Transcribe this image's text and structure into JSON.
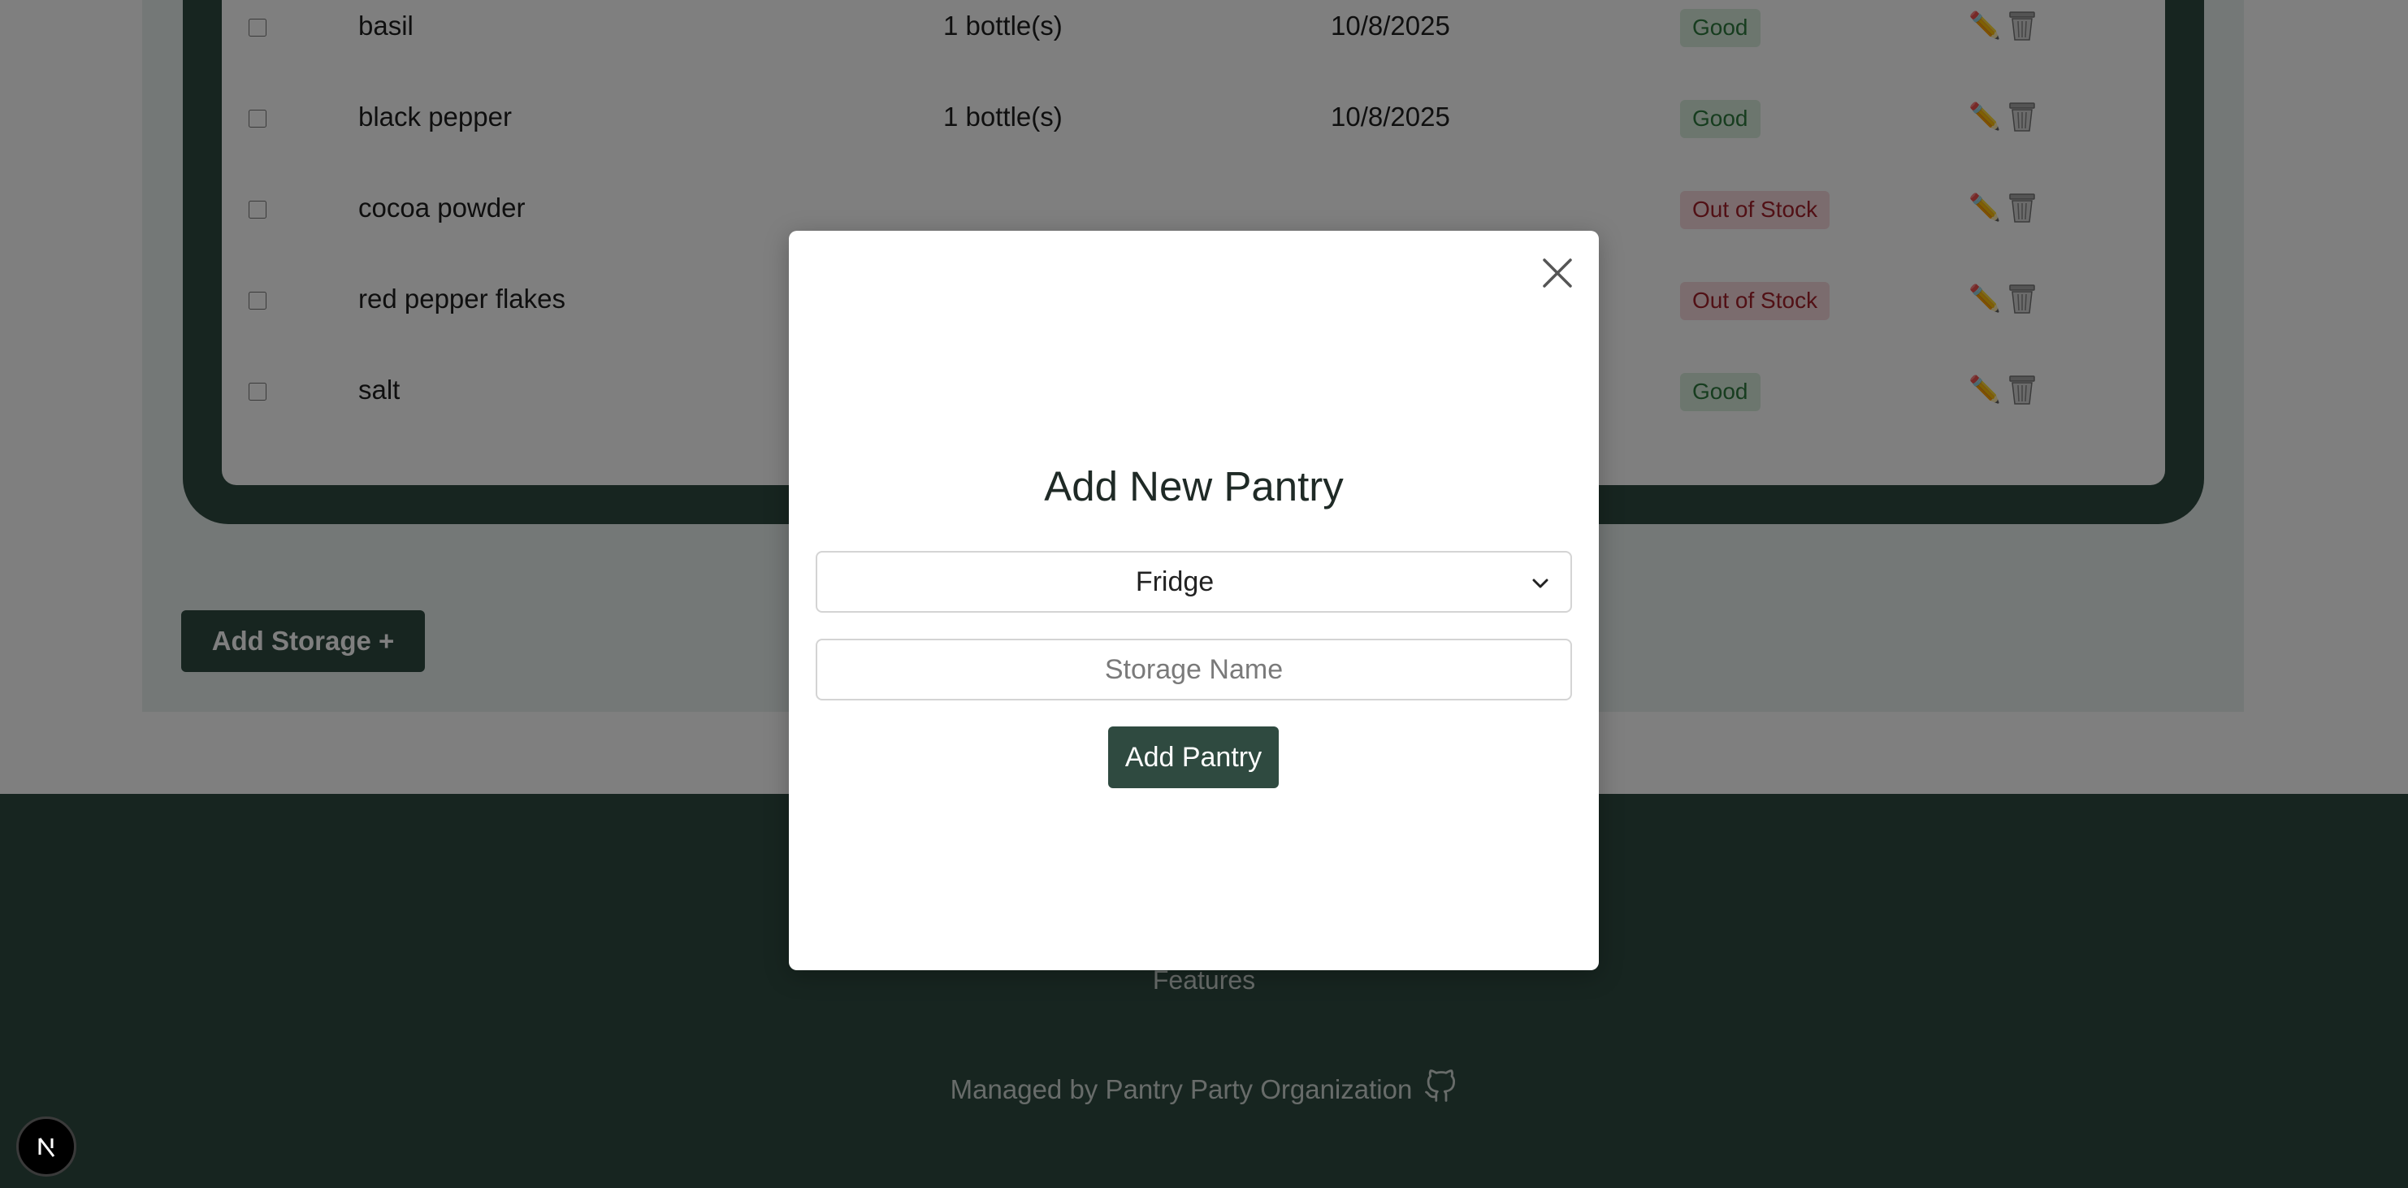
{
  "table": {
    "rows": [
      {
        "name": "basil",
        "quantity": "1 bottle(s)",
        "date": "10/8/2025",
        "status": "Good",
        "status_type": "good"
      },
      {
        "name": "black pepper",
        "quantity": "1 bottle(s)",
        "date": "10/8/2025",
        "status": "Good",
        "status_type": "good"
      },
      {
        "name": "cocoa powder",
        "quantity": "",
        "date": "",
        "status": "Out of Stock",
        "status_type": "out"
      },
      {
        "name": "red pepper flakes",
        "quantity": "",
        "date": "",
        "status": "Out of Stock",
        "status_type": "out"
      },
      {
        "name": "salt",
        "quantity": "",
        "date": "",
        "status": "Good",
        "status_type": "good"
      }
    ],
    "edit_icon": "pencil-icon",
    "delete_icon": "trash-icon"
  },
  "add_storage_label": "Add Storage +",
  "modal": {
    "title": "Add New Pantry",
    "select_value": "Fridge",
    "storage_name_placeholder": "Storage Name",
    "storage_name_value": "",
    "submit_label": "Add Pantry",
    "close_icon": "close-icon"
  },
  "footer": {
    "features_link": "Features",
    "managed_text": "Managed by Pantry Party Organization",
    "github_icon": "github-icon"
  },
  "colors": {
    "brand": "#2f4a40",
    "good_bg": "#d8ecdd",
    "good_text": "#2e7a3f",
    "out_bg": "#f6d9dc",
    "out_text": "#a3202b"
  }
}
